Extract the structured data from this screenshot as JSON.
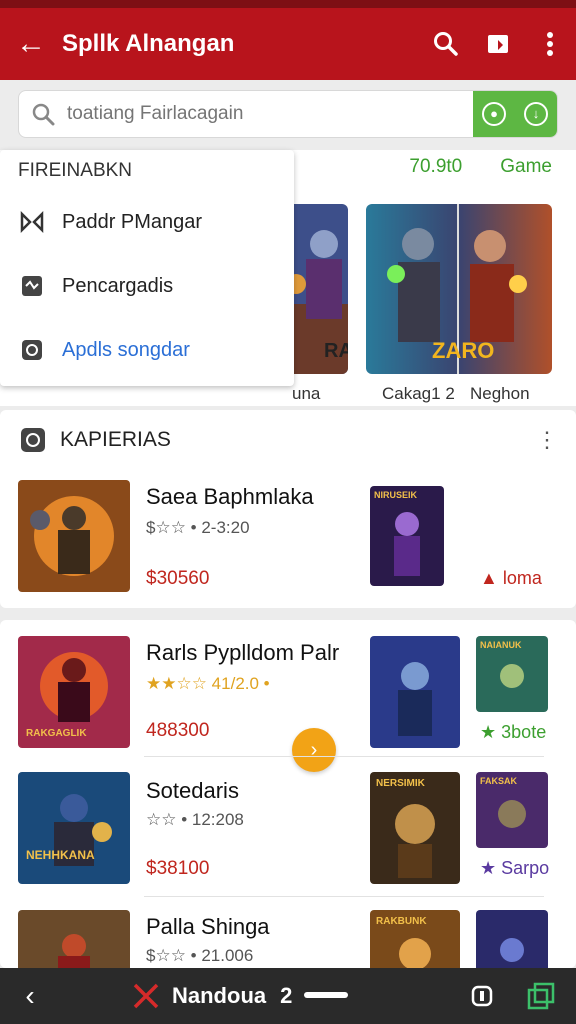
{
  "appbar": {
    "title": "Spllk Alnangan"
  },
  "search": {
    "placeholder": "toatiang Fairlacagain"
  },
  "dropdown": {
    "header": "FIREINABKN",
    "items": [
      {
        "label": "Paddr PMangar",
        "icon": "gamepad-icon"
      },
      {
        "label": "Pencargadis",
        "icon": "download-icon"
      },
      {
        "label": "Apdls songdar",
        "icon": "refresh-icon"
      }
    ]
  },
  "featured": {
    "stat": "70.9t0",
    "tab": "Game",
    "captions": [
      "una",
      "Cakag1 2",
      "Neghon"
    ],
    "banner_text": [
      "RA",
      "ZARO"
    ]
  },
  "section1": {
    "title": "KAPIERIAS",
    "more": "⋮"
  },
  "games": [
    {
      "name": "Saea Baphmlaka",
      "rating": "$☆☆ • 2-3:20",
      "price": "$30560",
      "tag": "loma"
    },
    {
      "name": "Rarls Pyplldom Palr",
      "rating": "★★☆☆ 41/2.0 •",
      "price": "488300",
      "tag": "3bote"
    },
    {
      "name": "Sotedaris",
      "rating": "☆☆ • 12:208",
      "price": "$38100",
      "tag": "Sarpo"
    },
    {
      "name": "Palla Shinga",
      "rating": "$☆☆ • 21.006",
      "price": "",
      "tag": ""
    }
  ],
  "thumb_labels": [
    "RAKGAGLIK",
    "NEHHKANA",
    "NIRUSEIK",
    "NERSIMIK",
    "NAIANUK",
    "FAKSAK",
    "RAKBUNK"
  ],
  "colors": {
    "brand": "#b8141c",
    "green": "#5db743",
    "price": "#c0261e",
    "link": "#2b6fd6",
    "fab": "#f2a316"
  },
  "navbar": {
    "label": "Nandoua",
    "label_suffix": "2"
  }
}
